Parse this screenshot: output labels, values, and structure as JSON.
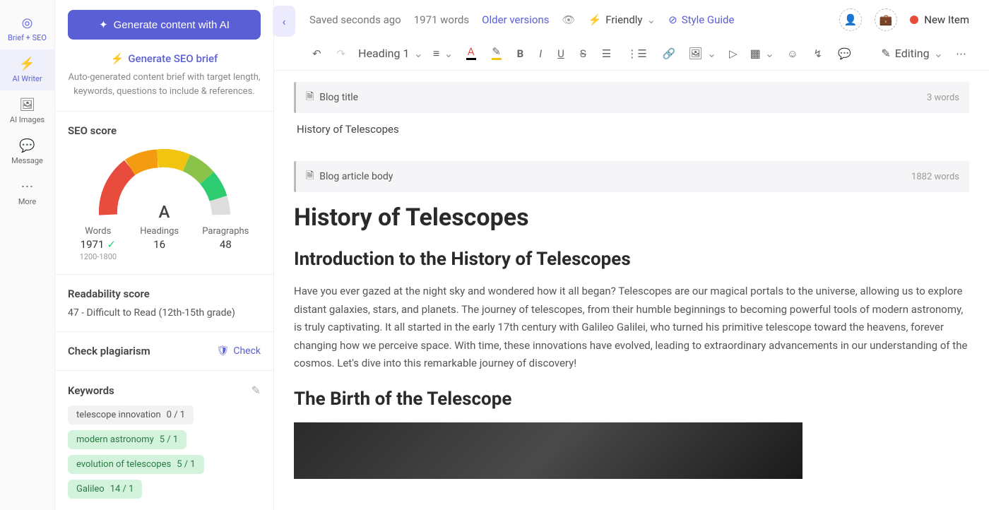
{
  "leftNav": {
    "items": [
      {
        "icon": "◎",
        "label": "Brief + SEO"
      },
      {
        "icon": "⚡",
        "label": "AI Writer"
      },
      {
        "icon": "🖼",
        "label": "AI Images"
      },
      {
        "icon": "💬",
        "label": "Message"
      },
      {
        "icon": "⋯",
        "label": "More"
      }
    ]
  },
  "sidebar": {
    "generateBtn": "Generate content with AI",
    "seoBriefLink": "Generate SEO brief",
    "seoBriefDesc": "Auto-generated content brief with target length, keywords, questions to include & references.",
    "seoScoreTitle": "SEO score",
    "gaugeLetter": "A",
    "stats": {
      "words": {
        "label": "Words",
        "value": "1971",
        "range": "1200-1800"
      },
      "headings": {
        "label": "Headings",
        "value": "16"
      },
      "paragraphs": {
        "label": "Paragraphs",
        "value": "48"
      }
    },
    "readabilityTitle": "Readability score",
    "readabilityText": "47 - Difficult to Read (12th-15th grade)",
    "plagiarismTitle": "Check plagiarism",
    "plagiarismCheck": "Check",
    "keywordsTitle": "Keywords",
    "keywords": [
      {
        "text": "telescope innovation",
        "count": "0 / 1",
        "style": "neutral"
      },
      {
        "text": "modern astronomy",
        "count": "5 / 1",
        "style": "green"
      },
      {
        "text": "evolution of telescopes",
        "count": "5 / 1",
        "style": "green"
      },
      {
        "text": "Galileo",
        "count": "14 / 1",
        "style": "green"
      }
    ]
  },
  "topbar": {
    "saved": "Saved seconds ago",
    "wordCount": "1971 words",
    "olderVersions": "Older versions",
    "toneLabel": "Friendly",
    "styleGuide": "Style Guide",
    "newItem": "New Item"
  },
  "toolbar": {
    "headingSel": "Heading 1",
    "editing": "Editing"
  },
  "content": {
    "titleField": {
      "label": "Blog title",
      "words": "3 words"
    },
    "titleText": "History of Telescopes",
    "bodyField": {
      "label": "Blog article body",
      "words": "1882 words"
    },
    "h1": "History of Telescopes",
    "h2a": "Introduction to the History of Telescopes",
    "p1": "Have you ever gazed at the night sky and wondered how it all began? Telescopes are our magical portals to the universe, allowing us to explore distant galaxies, stars, and planets. The journey of telescopes, from their humble beginnings to becoming powerful tools of modern astronomy, is truly captivating. It all started in the early 17th century with Galileo Galilei, who turned his primitive telescope toward the heavens, forever changing how we perceive space. With time, these innovations have evolved, leading to extraordinary advancements in our understanding of the cosmos. Let's dive into this remarkable journey of discovery!",
    "h2b": "The Birth of the Telescope"
  }
}
